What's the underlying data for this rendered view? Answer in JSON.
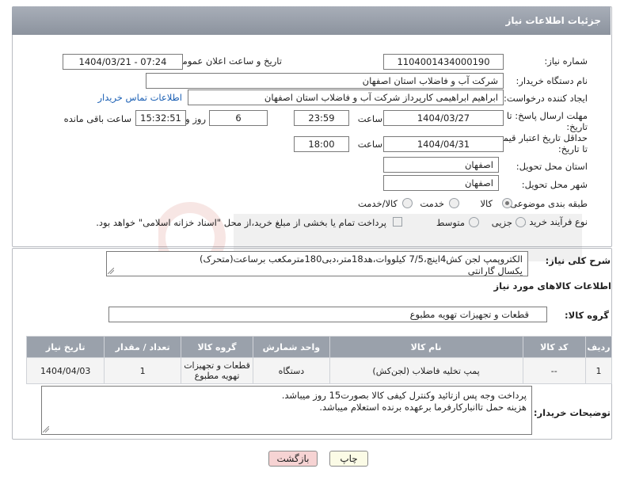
{
  "header": {
    "title": "جزئیات اطلاعات نیاز"
  },
  "form": {
    "need_number_label": "شماره نیاز:",
    "need_number": "1104001434000190",
    "announce_label": "تاریخ و ساعت اعلان عمومی:",
    "announce_value": "1404/03/21 - 07:24",
    "buyer_org_label": "نام دستگاه خریدار:",
    "buyer_org": "شرکت آب و فاضلاب استان اصفهان",
    "creator_label": "ایجاد کننده درخواست:",
    "creator": "ابراهیم ابراهیمی کارپرداز شرکت آب و فاضلاب استان اصفهان",
    "contact_link": "اطلاعات تماس خریدار",
    "deadline_label": "مهلت ارسال پاسخ: تا تاریخ:",
    "deadline_date": "1404/03/27",
    "time_label": "ساعت",
    "deadline_time": "23:59",
    "days": "6",
    "days_label": "روز و",
    "remaining": "15:32:51",
    "remaining_label": "ساعت باقی مانده",
    "price_label": "حداقل تاریخ اعتبار قیمت: تا تاریخ:",
    "price_date": "1404/04/31",
    "price_time": "18:00",
    "province_label": "استان محل تحویل:",
    "province": "اصفهان",
    "city_label": "شهر محل تحویل:",
    "city": "اصفهان",
    "category_label": "طبقه بندی موضوعی:",
    "cat_goods": "کالا",
    "cat_service": "خدمت",
    "cat_both": "کالا/خدمت",
    "process_label": "نوع فرآیند خرید :",
    "proc_partial": "جزیی",
    "proc_medium": "متوسط",
    "proc_note": "پرداخت تمام یا بخشی از مبلغ خرید،از محل \"اسناد خزانه اسلامی\" خواهد بود."
  },
  "summary": {
    "label": "شرح کلی نیاز:",
    "line1": "الکتروپمپ لجن کش4اینچ،7/5 کیلووات،هد18متر،دبی180مترمکعب برساعت(متحرک)",
    "line2": "یکسال گارانتی"
  },
  "goods": {
    "section_title": "اطلاعات کالاهای مورد نیاز",
    "group_label": "گروه کالا:",
    "group_value": "قطعات و تجهیزات تهویه مطبوع",
    "columns": [
      "ردیف",
      "کد کالا",
      "نام کالا",
      "واحد شمارش",
      "گروه کالا",
      "تعداد / مقدار",
      "تاریخ نیاز"
    ],
    "rows": [
      {
        "row": "1",
        "code": "--",
        "name": "پمپ تخلیه فاضلاب (لجن‌کش)",
        "unit": "دستگاه",
        "group": "قطعات و تجهیزات تهویه مطبوع",
        "qty": "1",
        "date": "1404/04/03"
      }
    ]
  },
  "buyer_notes": {
    "label": "توضیحات خریدار:",
    "line1": "پرداخت وجه پس ازتائید وکنترل کیفی کالا بصورت15 روز میباشد.",
    "line2": "هزینه حمل تاانبارکارفرما برعهده برنده استعلام میباشد."
  },
  "buttons": {
    "print": "چاپ",
    "back": "بازگشت"
  },
  "colors": {
    "header_bg": "#98a0ab",
    "table_head": "#9aa1ab",
    "link": "#1a5fb4",
    "back_btn": "#f6d3d3",
    "print_btn": "#fbfbe6"
  }
}
